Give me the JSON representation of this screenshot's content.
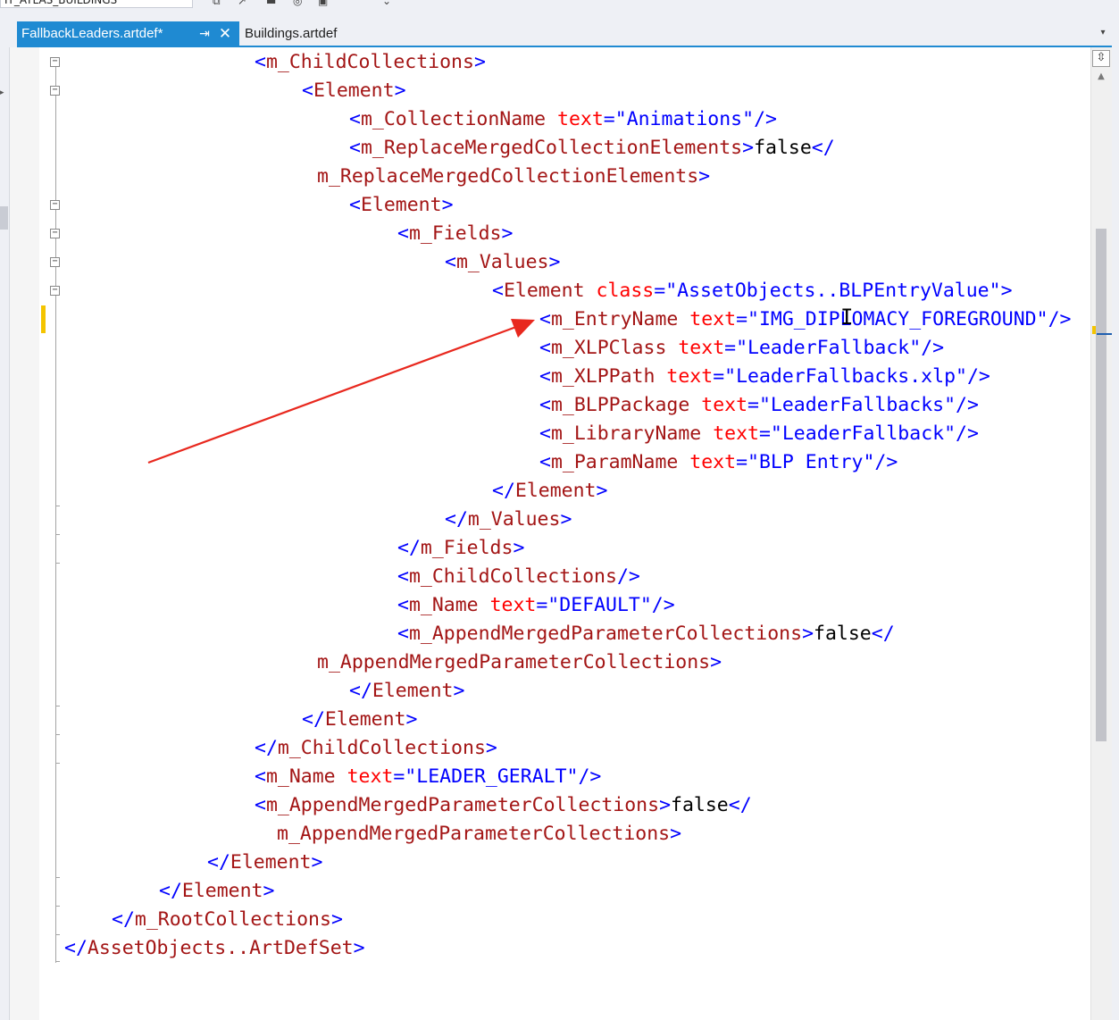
{
  "toolbar": {
    "project_box_text": "IT_ATLAS_BUILDINGS",
    "icons": [
      "solution-explorer-icon",
      "arrow-icon",
      "save-icon",
      "refresh-icon",
      "collapse-icon",
      "dropdown-icon"
    ]
  },
  "tabs": [
    {
      "label": "FallbackLeaders.artdef*",
      "active": true,
      "pin_glyph": "⇥",
      "close_glyph": "✕"
    },
    {
      "label": "Buildings.artdef",
      "active": false
    }
  ],
  "tab_overflow_glyph": "▾",
  "editor": {
    "split_glyph": "⇳",
    "scroll_up_glyph": "▲",
    "lines": [
      [
        [
          "pu",
          "<"
        ],
        [
          "el",
          "m_ChildCollections"
        ],
        [
          "pu",
          ">"
        ]
      ],
      [
        [
          "pu",
          "<"
        ],
        [
          "el",
          "Element"
        ],
        [
          "pu",
          ">"
        ]
      ],
      [
        [
          "pu",
          "<"
        ],
        [
          "el",
          "m_CollectionName"
        ],
        [
          "tx",
          " "
        ],
        [
          "at",
          "text"
        ],
        [
          "pu",
          "=\""
        ],
        [
          "av",
          "Animations"
        ],
        [
          "pu",
          "\"/>"
        ]
      ],
      [
        [
          "pu",
          "<"
        ],
        [
          "el",
          "m_ReplaceMergedCollectionElements"
        ],
        [
          "pu",
          ">"
        ],
        [
          "tx",
          "false"
        ],
        [
          "pu",
          "</"
        ]
      ],
      [
        [
          "el",
          "m_ReplaceMergedCollectionElements"
        ],
        [
          "pu",
          ">"
        ]
      ],
      [
        [
          "pu",
          "<"
        ],
        [
          "el",
          "Element"
        ],
        [
          "pu",
          ">"
        ]
      ],
      [
        [
          "pu",
          "<"
        ],
        [
          "el",
          "m_Fields"
        ],
        [
          "pu",
          ">"
        ]
      ],
      [
        [
          "pu",
          "<"
        ],
        [
          "el",
          "m_Values"
        ],
        [
          "pu",
          ">"
        ]
      ],
      [
        [
          "pu",
          "<"
        ],
        [
          "el",
          "Element"
        ],
        [
          "tx",
          " "
        ],
        [
          "at",
          "class"
        ],
        [
          "pu",
          "=\""
        ],
        [
          "av",
          "AssetObjects..BLPEntryValue"
        ],
        [
          "pu",
          "\">"
        ]
      ],
      [
        [
          "pu",
          "<"
        ],
        [
          "el",
          "m_EntryName"
        ],
        [
          "tx",
          " "
        ],
        [
          "at",
          "text"
        ],
        [
          "pu",
          "=\""
        ],
        [
          "av",
          "IMG_DIPLOMACY_FOREGROUND"
        ],
        [
          "pu",
          "\"/>"
        ]
      ],
      [
        [
          "pu",
          "<"
        ],
        [
          "el",
          "m_XLPClass"
        ],
        [
          "tx",
          " "
        ],
        [
          "at",
          "text"
        ],
        [
          "pu",
          "=\""
        ],
        [
          "av",
          "LeaderFallback"
        ],
        [
          "pu",
          "\"/>"
        ]
      ],
      [
        [
          "pu",
          "<"
        ],
        [
          "el",
          "m_XLPPath"
        ],
        [
          "tx",
          " "
        ],
        [
          "at",
          "text"
        ],
        [
          "pu",
          "=\""
        ],
        [
          "av",
          "LeaderFallbacks.xlp"
        ],
        [
          "pu",
          "\"/>"
        ]
      ],
      [
        [
          "pu",
          "<"
        ],
        [
          "el",
          "m_BLPPackage"
        ],
        [
          "tx",
          " "
        ],
        [
          "at",
          "text"
        ],
        [
          "pu",
          "=\""
        ],
        [
          "av",
          "LeaderFallbacks"
        ],
        [
          "pu",
          "\"/>"
        ]
      ],
      [
        [
          "pu",
          "<"
        ],
        [
          "el",
          "m_LibraryName"
        ],
        [
          "tx",
          " "
        ],
        [
          "at",
          "text"
        ],
        [
          "pu",
          "=\""
        ],
        [
          "av",
          "LeaderFallback"
        ],
        [
          "pu",
          "\"/>"
        ]
      ],
      [
        [
          "pu",
          "<"
        ],
        [
          "el",
          "m_ParamName"
        ],
        [
          "tx",
          " "
        ],
        [
          "at",
          "text"
        ],
        [
          "pu",
          "=\""
        ],
        [
          "av",
          "BLP Entry"
        ],
        [
          "pu",
          "\"/>"
        ]
      ],
      [
        [
          "pu",
          "</"
        ],
        [
          "el",
          "Element"
        ],
        [
          "pu",
          ">"
        ]
      ],
      [
        [
          "pu",
          "</"
        ],
        [
          "el",
          "m_Values"
        ],
        [
          "pu",
          ">"
        ]
      ],
      [
        [
          "pu",
          "</"
        ],
        [
          "el",
          "m_Fields"
        ],
        [
          "pu",
          ">"
        ]
      ],
      [
        [
          "pu",
          "<"
        ],
        [
          "el",
          "m_ChildCollections"
        ],
        [
          "pu",
          "/>"
        ]
      ],
      [
        [
          "pu",
          "<"
        ],
        [
          "el",
          "m_Name"
        ],
        [
          "tx",
          " "
        ],
        [
          "at",
          "text"
        ],
        [
          "pu",
          "=\""
        ],
        [
          "av",
          "DEFAULT"
        ],
        [
          "pu",
          "\"/>"
        ]
      ],
      [
        [
          "pu",
          "<"
        ],
        [
          "el",
          "m_AppendMergedParameterCollections"
        ],
        [
          "pu",
          ">"
        ],
        [
          "tx",
          "false"
        ],
        [
          "pu",
          "</"
        ]
      ],
      [
        [
          "el",
          "m_AppendMergedParameterCollections"
        ],
        [
          "pu",
          ">"
        ]
      ],
      [
        [
          "pu",
          "</"
        ],
        [
          "el",
          "Element"
        ],
        [
          "pu",
          ">"
        ]
      ],
      [
        [
          "pu",
          "</"
        ],
        [
          "el",
          "Element"
        ],
        [
          "pu",
          ">"
        ]
      ],
      [
        [
          "pu",
          "</"
        ],
        [
          "el",
          "m_ChildCollections"
        ],
        [
          "pu",
          ">"
        ]
      ],
      [
        [
          "pu",
          "<"
        ],
        [
          "el",
          "m_Name"
        ],
        [
          "tx",
          " "
        ],
        [
          "at",
          "text"
        ],
        [
          "pu",
          "=\""
        ],
        [
          "av",
          "LEADER_GERALT"
        ],
        [
          "pu",
          "\"/>"
        ]
      ],
      [
        [
          "pu",
          "<"
        ],
        [
          "el",
          "m_AppendMergedParameterCollections"
        ],
        [
          "pu",
          ">"
        ],
        [
          "tx",
          "false"
        ],
        [
          "pu",
          "</"
        ]
      ],
      [
        [
          "el",
          "m_AppendMergedParameterCollections"
        ],
        [
          "pu",
          ">"
        ]
      ],
      [
        [
          "pu",
          "</"
        ],
        [
          "el",
          "Element"
        ],
        [
          "pu",
          ">"
        ]
      ],
      [
        [
          "pu",
          "</"
        ],
        [
          "el",
          "Element"
        ],
        [
          "pu",
          ">"
        ]
      ],
      [
        [
          "pu",
          "</"
        ],
        [
          "el",
          "m_RootCollections"
        ],
        [
          "pu",
          ">"
        ]
      ],
      [
        [
          "pu",
          "</"
        ],
        [
          "el",
          "AssetObjects..ArtDefSet"
        ],
        [
          "pu",
          ">"
        ]
      ]
    ]
  },
  "annotation": {
    "color": "#e8281e",
    "type": "red-arrow"
  },
  "colors": {
    "tab_active_bg": "#1f8ad2",
    "element_name": "#a31515",
    "attribute_name": "#ff0000",
    "attribute_value": "#0000ff",
    "punctuation": "#0000ff",
    "text": "#000000",
    "change_marker": "#f4c400"
  }
}
